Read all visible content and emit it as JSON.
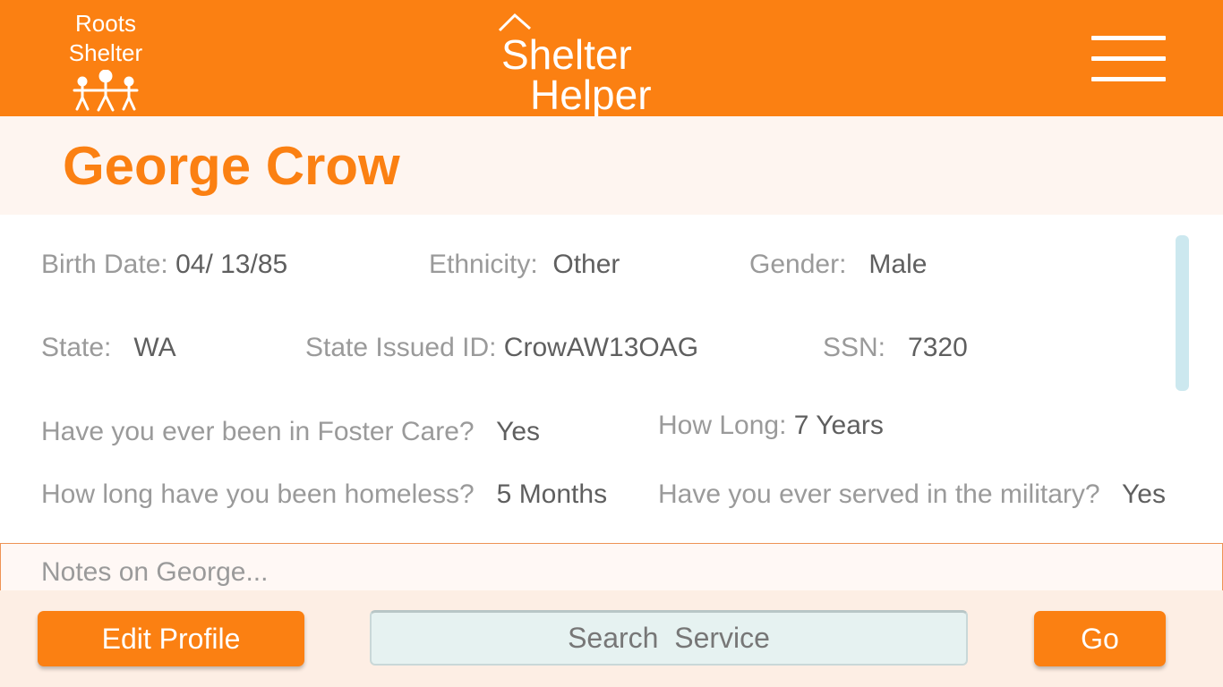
{
  "header": {
    "org_logo": {
      "line1": "Roots",
      "line2": "Shelter",
      "figures_icon": "people-family-icon"
    },
    "app_logo": {
      "line1": "Shelter",
      "line2": "Helper",
      "roof_icon": "house-roof-icon"
    },
    "menu_icon": "hamburger-menu-icon"
  },
  "client": {
    "name": "George Crow"
  },
  "profile": {
    "birth_date": {
      "label": "Birth Date:",
      "value": "04/ 13/85"
    },
    "ethnicity": {
      "label": "Ethnicity:",
      "value": "Other"
    },
    "gender": {
      "label": "Gender:",
      "value": "Male"
    },
    "state": {
      "label": "State:",
      "value": "WA"
    },
    "state_id": {
      "label": "State Issued ID:",
      "value": "CrowAW13OAG"
    },
    "ssn": {
      "label": "SSN:",
      "value": "7320"
    },
    "foster_care": {
      "label": "Have you ever been in Foster Care?",
      "value": "Yes"
    },
    "how_long": {
      "label": "How Long:",
      "value": "7 Years"
    },
    "homeless_duration": {
      "label": "How long have you been homeless?",
      "value": "5 Months"
    },
    "military": {
      "label": "Have you ever served in the military?",
      "value": "Yes"
    }
  },
  "notes": {
    "placeholder": "Notes on George..."
  },
  "footer": {
    "edit_label": "Edit Profile",
    "search_placeholder": "Search  Service",
    "go_label": "Go"
  },
  "colors": {
    "brand_orange": "#fb8012",
    "name_bar_bg": "#fef5f0",
    "footer_bg": "#fdeee4",
    "search_bg": "#e6f2f1",
    "scrollbar": "#cce8ef",
    "label_gray": "#9a9a9a",
    "value_gray": "#5f5f5f"
  }
}
